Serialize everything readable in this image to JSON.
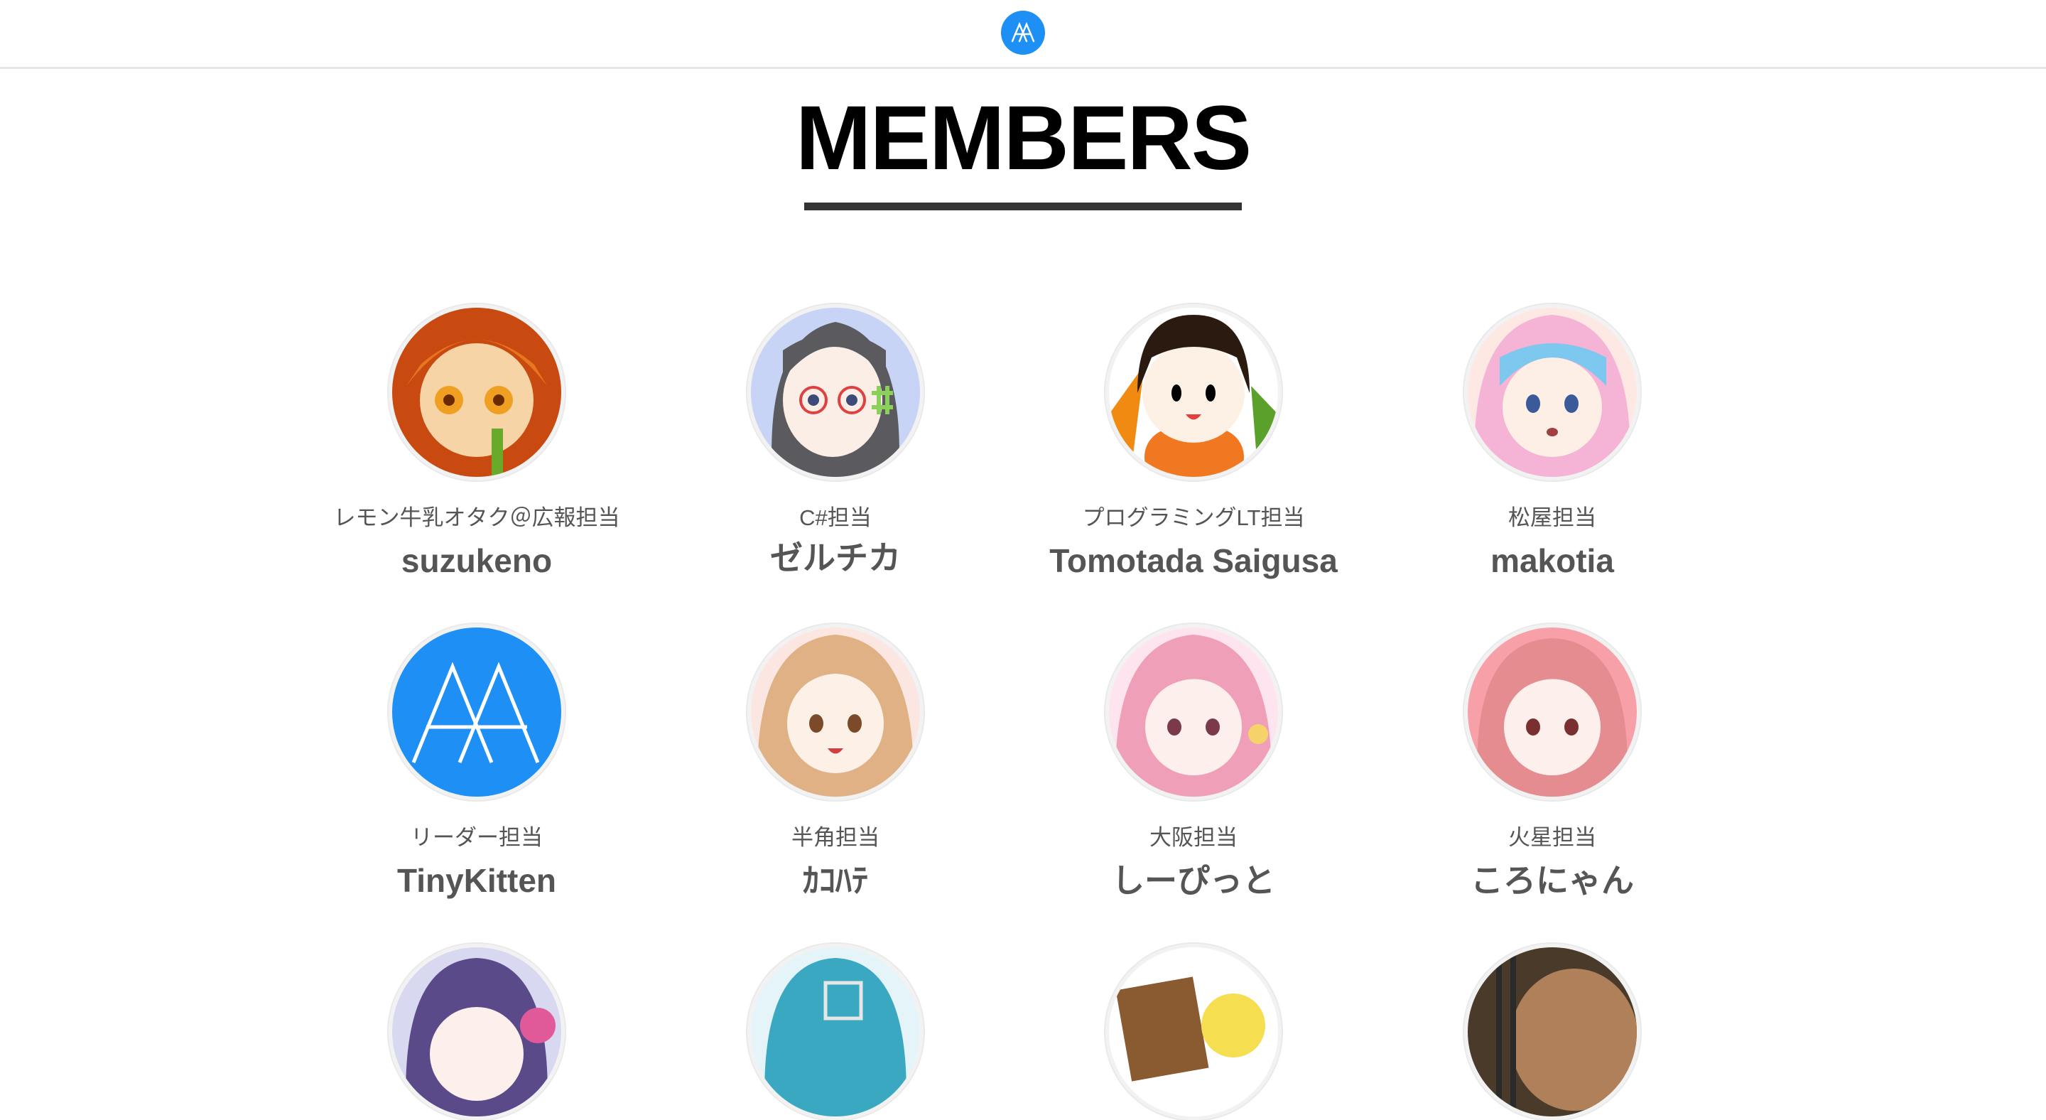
{
  "header": {
    "logo_icon": "aa-logo-icon",
    "accent": "#1e90f5"
  },
  "page": {
    "title": "MEMBERS"
  },
  "members": [
    {
      "role": "レモン牛乳オタク＠広報担当",
      "name": "suzukeno",
      "avatar_icon": "orange-haired-girl-avatar"
    },
    {
      "role": "C#担当",
      "name": "ゼルチカ",
      "avatar_icon": "glasses-girl-avatar"
    },
    {
      "role": "プログラミングLT担当",
      "name": "Tomotada Saigusa",
      "avatar_icon": "chibi-boy-avatar"
    },
    {
      "role": "松屋担当",
      "name": "makotia",
      "avatar_icon": "blue-haired-hood-avatar"
    },
    {
      "role": "リーダー担当",
      "name": "TinyKitten",
      "avatar_icon": "aa-logo-avatar"
    },
    {
      "role": "半角担当",
      "name": "ｶｺﾊﾃ",
      "avatar_icon": "blonde-girl-avatar"
    },
    {
      "role": "大阪担当",
      "name": "しーぴっと",
      "avatar_icon": "pink-haired-girl-avatar"
    },
    {
      "role": "火星担当",
      "name": "ころにゃん",
      "avatar_icon": "red-haired-girl-avatar"
    },
    {
      "role": "",
      "name": "",
      "avatar_icon": "purple-haired-headphones-avatar"
    },
    {
      "role": "",
      "name": "",
      "avatar_icon": "teal-hair-avatar"
    },
    {
      "role": "",
      "name": "",
      "avatar_icon": "chick-sign-avatar"
    },
    {
      "role": "",
      "name": "",
      "avatar_icon": "guitar-photo-avatar"
    }
  ]
}
